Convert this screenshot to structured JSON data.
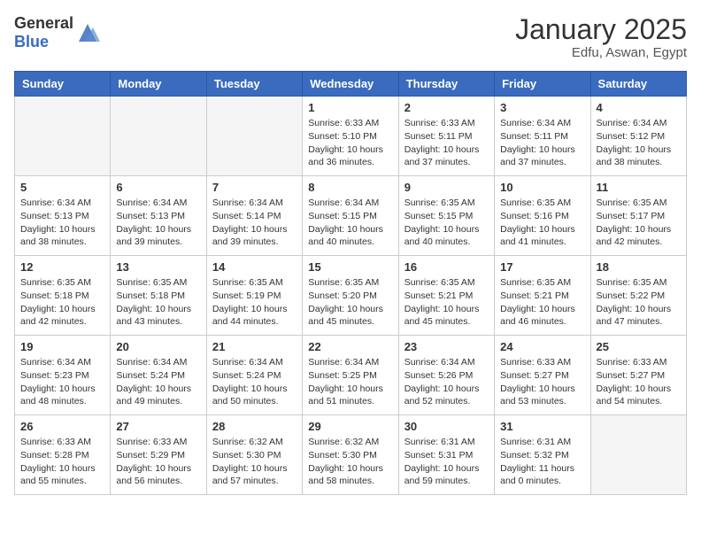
{
  "header": {
    "logo": {
      "general": "General",
      "blue": "Blue"
    },
    "title": "January 2025",
    "subtitle": "Edfu, Aswan, Egypt"
  },
  "weekdays": [
    "Sunday",
    "Monday",
    "Tuesday",
    "Wednesday",
    "Thursday",
    "Friday",
    "Saturday"
  ],
  "weeks": [
    [
      {
        "day": "",
        "empty": true
      },
      {
        "day": "",
        "empty": true
      },
      {
        "day": "",
        "empty": true
      },
      {
        "day": "1",
        "sunrise": "6:33 AM",
        "sunset": "5:10 PM",
        "daylight": "10 hours and 36 minutes."
      },
      {
        "day": "2",
        "sunrise": "6:33 AM",
        "sunset": "5:11 PM",
        "daylight": "10 hours and 37 minutes."
      },
      {
        "day": "3",
        "sunrise": "6:34 AM",
        "sunset": "5:11 PM",
        "daylight": "10 hours and 37 minutes."
      },
      {
        "day": "4",
        "sunrise": "6:34 AM",
        "sunset": "5:12 PM",
        "daylight": "10 hours and 38 minutes."
      }
    ],
    [
      {
        "day": "5",
        "sunrise": "6:34 AM",
        "sunset": "5:13 PM",
        "daylight": "10 hours and 38 minutes."
      },
      {
        "day": "6",
        "sunrise": "6:34 AM",
        "sunset": "5:13 PM",
        "daylight": "10 hours and 39 minutes."
      },
      {
        "day": "7",
        "sunrise": "6:34 AM",
        "sunset": "5:14 PM",
        "daylight": "10 hours and 39 minutes."
      },
      {
        "day": "8",
        "sunrise": "6:34 AM",
        "sunset": "5:15 PM",
        "daylight": "10 hours and 40 minutes."
      },
      {
        "day": "9",
        "sunrise": "6:35 AM",
        "sunset": "5:15 PM",
        "daylight": "10 hours and 40 minutes."
      },
      {
        "day": "10",
        "sunrise": "6:35 AM",
        "sunset": "5:16 PM",
        "daylight": "10 hours and 41 minutes."
      },
      {
        "day": "11",
        "sunrise": "6:35 AM",
        "sunset": "5:17 PM",
        "daylight": "10 hours and 42 minutes."
      }
    ],
    [
      {
        "day": "12",
        "sunrise": "6:35 AM",
        "sunset": "5:18 PM",
        "daylight": "10 hours and 42 minutes."
      },
      {
        "day": "13",
        "sunrise": "6:35 AM",
        "sunset": "5:18 PM",
        "daylight": "10 hours and 43 minutes."
      },
      {
        "day": "14",
        "sunrise": "6:35 AM",
        "sunset": "5:19 PM",
        "daylight": "10 hours and 44 minutes."
      },
      {
        "day": "15",
        "sunrise": "6:35 AM",
        "sunset": "5:20 PM",
        "daylight": "10 hours and 45 minutes."
      },
      {
        "day": "16",
        "sunrise": "6:35 AM",
        "sunset": "5:21 PM",
        "daylight": "10 hours and 45 minutes."
      },
      {
        "day": "17",
        "sunrise": "6:35 AM",
        "sunset": "5:21 PM",
        "daylight": "10 hours and 46 minutes."
      },
      {
        "day": "18",
        "sunrise": "6:35 AM",
        "sunset": "5:22 PM",
        "daylight": "10 hours and 47 minutes."
      }
    ],
    [
      {
        "day": "19",
        "sunrise": "6:34 AM",
        "sunset": "5:23 PM",
        "daylight": "10 hours and 48 minutes."
      },
      {
        "day": "20",
        "sunrise": "6:34 AM",
        "sunset": "5:24 PM",
        "daylight": "10 hours and 49 minutes."
      },
      {
        "day": "21",
        "sunrise": "6:34 AM",
        "sunset": "5:24 PM",
        "daylight": "10 hours and 50 minutes."
      },
      {
        "day": "22",
        "sunrise": "6:34 AM",
        "sunset": "5:25 PM",
        "daylight": "10 hours and 51 minutes."
      },
      {
        "day": "23",
        "sunrise": "6:34 AM",
        "sunset": "5:26 PM",
        "daylight": "10 hours and 52 minutes."
      },
      {
        "day": "24",
        "sunrise": "6:33 AM",
        "sunset": "5:27 PM",
        "daylight": "10 hours and 53 minutes."
      },
      {
        "day": "25",
        "sunrise": "6:33 AM",
        "sunset": "5:27 PM",
        "daylight": "10 hours and 54 minutes."
      }
    ],
    [
      {
        "day": "26",
        "sunrise": "6:33 AM",
        "sunset": "5:28 PM",
        "daylight": "10 hours and 55 minutes."
      },
      {
        "day": "27",
        "sunrise": "6:33 AM",
        "sunset": "5:29 PM",
        "daylight": "10 hours and 56 minutes."
      },
      {
        "day": "28",
        "sunrise": "6:32 AM",
        "sunset": "5:30 PM",
        "daylight": "10 hours and 57 minutes."
      },
      {
        "day": "29",
        "sunrise": "6:32 AM",
        "sunset": "5:30 PM",
        "daylight": "10 hours and 58 minutes."
      },
      {
        "day": "30",
        "sunrise": "6:31 AM",
        "sunset": "5:31 PM",
        "daylight": "10 hours and 59 minutes."
      },
      {
        "day": "31",
        "sunrise": "6:31 AM",
        "sunset": "5:32 PM",
        "daylight": "11 hours and 0 minutes."
      },
      {
        "day": "",
        "empty": true
      }
    ]
  ]
}
